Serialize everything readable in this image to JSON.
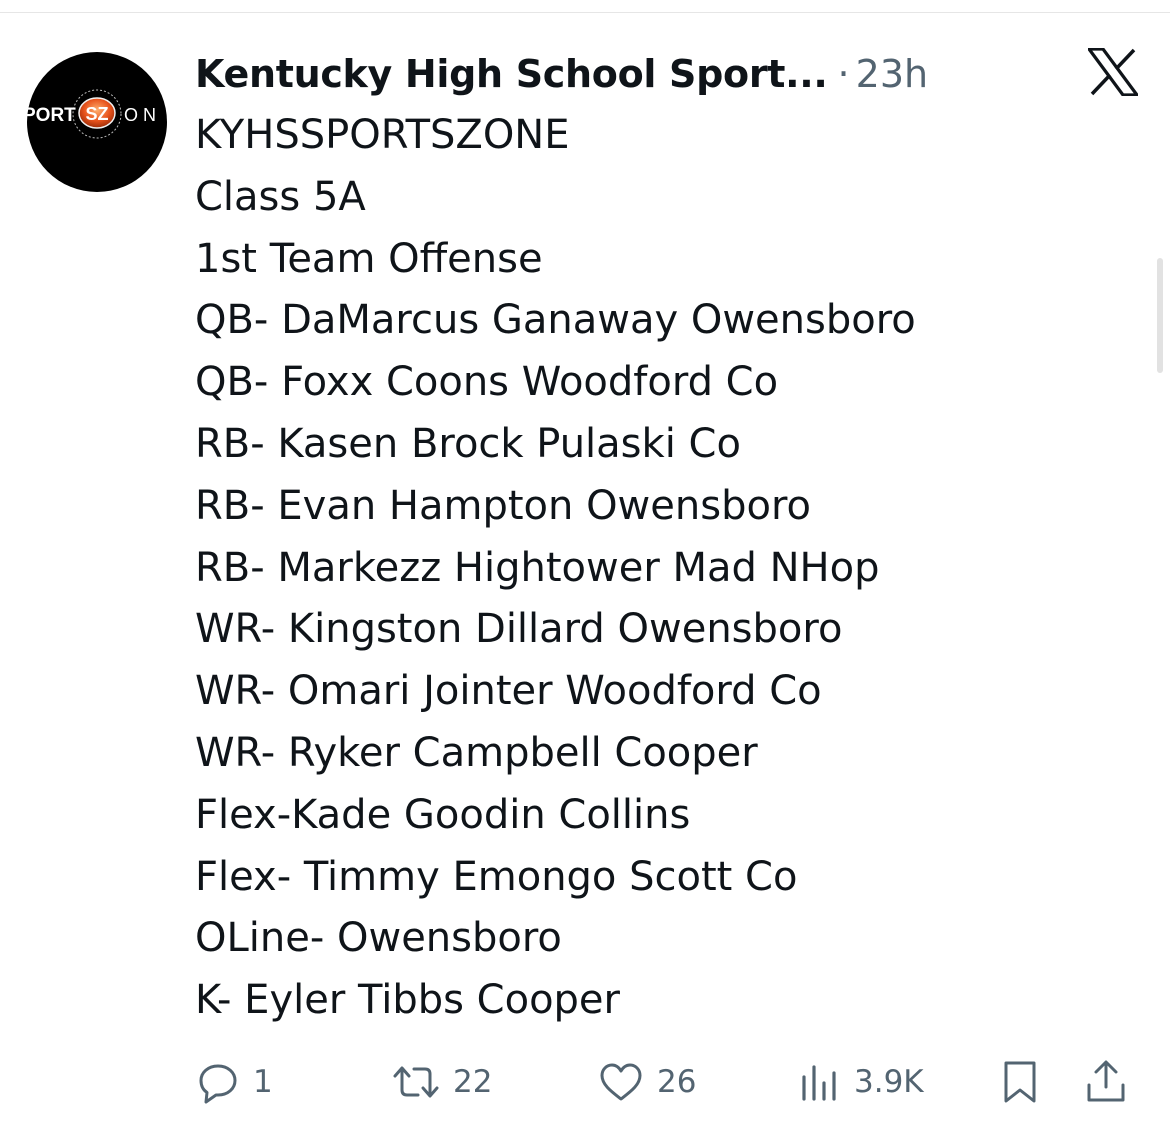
{
  "tweet": {
    "author": "Kentucky High School Sport...",
    "separator": "·",
    "timestamp": "23h",
    "avatar_text": {
      "left": "PORT",
      "badge": "SZ",
      "right": "O N"
    },
    "lines": [
      "KYHSSPORTSZONE",
      "Class 5A",
      "1st Team Offense",
      "QB- DaMarcus Ganaway Owensboro",
      "QB- Foxx Coons Woodford Co",
      "RB- Kasen Brock Pulaski Co",
      "RB- Evan Hampton Owensboro",
      "RB- Markezz Hightower Mad NHop",
      "WR- Kingston Dillard Owensboro",
      "WR- Omari Jointer Woodford Co",
      "WR- Ryker Campbell Cooper",
      "Flex-Kade Goodin Collins",
      "Flex- Timmy Emongo Scott Co",
      "OLine- Owensboro",
      "K- Eyler Tibbs Cooper"
    ]
  },
  "actions": {
    "replies": "1",
    "reposts": "22",
    "likes": "26",
    "views": "3.9K"
  },
  "icons": {
    "reply": "reply-icon",
    "repost": "repost-icon",
    "like": "heart-icon",
    "views": "views-icon",
    "bookmark": "bookmark-icon",
    "share": "share-icon",
    "platform": "x-logo-icon"
  },
  "colors": {
    "text": "#0f1419",
    "secondary": "#536471",
    "avatar_bg": "#000000",
    "avatar_accent": "#e8531c"
  }
}
